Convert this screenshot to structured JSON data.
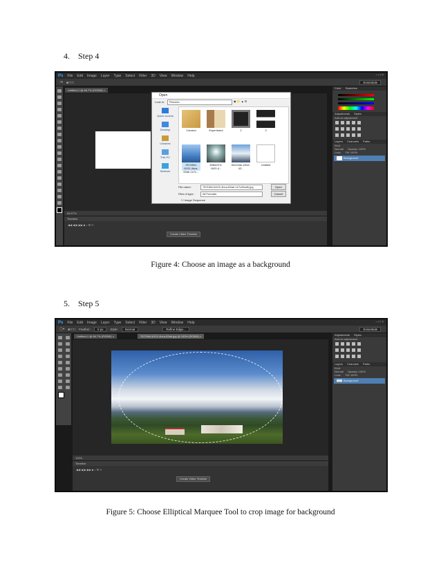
{
  "step4": {
    "heading": "4. Step 4",
    "caption": "Figure 4: Choose an image  as a background",
    "screenshot": {
      "menu": [
        "File",
        "Edit",
        "Image",
        "Layer",
        "Type",
        "Select",
        "Filter",
        "3D",
        "View",
        "Window",
        "Help"
      ],
      "logo": "Ps",
      "doc_tab": "Untitled-1 @ 66.7% (RGB/8) ×",
      "status": "66.67%",
      "timeline_label": "Timeline",
      "timeline_button": "Create Video Timeline",
      "essentials": "Essentials",
      "panels": {
        "color": "Color",
        "swatches": "Swatches",
        "adjustments": "Adjustments",
        "styles": "Styles",
        "add_adjustment": "Add an adjustment",
        "layers": "Layers",
        "channels": "Channels",
        "paths": "Paths",
        "kind": "Kind",
        "normal": "Normal",
        "opacity": "Opacity: 100%",
        "lock": "Lock:",
        "fill": "Fill: 100%",
        "layer_name": "Background"
      },
      "dialog": {
        "title": "Open",
        "look_in_label": "Look in:",
        "look_in_value": "Pictures",
        "nav": [
          "Quick access",
          "Desktop",
          "Libraries",
          "This PC",
          "Network"
        ],
        "thumbs": [
          "Camera",
          "Experiment",
          "2",
          "3",
          "7871f9ef-6102-4bca-83ab-1e7c...",
          "835d2f73-1620-4...",
          "fefc22ae-e944-42...",
          "Untitled"
        ],
        "file_name_label": "File name:",
        "file_name_value": "7871f9ef-6102-4bca-83ab-1e7c26a4b.jpg",
        "files_type_label": "Files of type:",
        "files_type_value": "All Formats",
        "open_button": "Open",
        "cancel_button": "Cancel",
        "image_sequence": "Image Sequence"
      }
    }
  },
  "step5": {
    "heading": "5. Step 5",
    "caption": "Figure 5: Choose Elliptical  Marquee Tool to crop image  for background",
    "screenshot": {
      "menu": [
        "File",
        "Edit",
        "Image",
        "Layer",
        "Type",
        "Select",
        "Filter",
        "3D",
        "View",
        "Window",
        "Help"
      ],
      "logo": "Ps",
      "doc_tabs": [
        "Untitled-1 @ 66.7% (RGB/8) ×",
        "7871f9ef-6102-4bca-83ab.jpg @ 100% (RGB/8) ×"
      ],
      "feather_label": "Feather:",
      "feather_value": "0 px",
      "style_label": "Style:",
      "style_value": "Normal",
      "refine_edge": "Refine Edge...",
      "status": "100%",
      "timeline_label": "Timeline",
      "timeline_button": "Create Video Timeline",
      "essentials": "Essentials",
      "panels": {
        "adjustments": "Adjustments",
        "styles": "Styles",
        "add_adjustment": "Add an adjustment",
        "layers": "Layers",
        "channels": "Channels",
        "paths": "Paths",
        "kind": "Kind",
        "normal": "Normal",
        "opacity": "Opacity: 100%",
        "lock": "Lock:",
        "fill": "Fill: 100%",
        "layer_name": "Background"
      }
    }
  },
  "colors": {
    "ps_dark": "#262626",
    "ps_panel": "#3a3a3a",
    "layer_selected": "#4f7fb3",
    "sky": "#4a79b8",
    "grass": "#4d6b2a"
  }
}
